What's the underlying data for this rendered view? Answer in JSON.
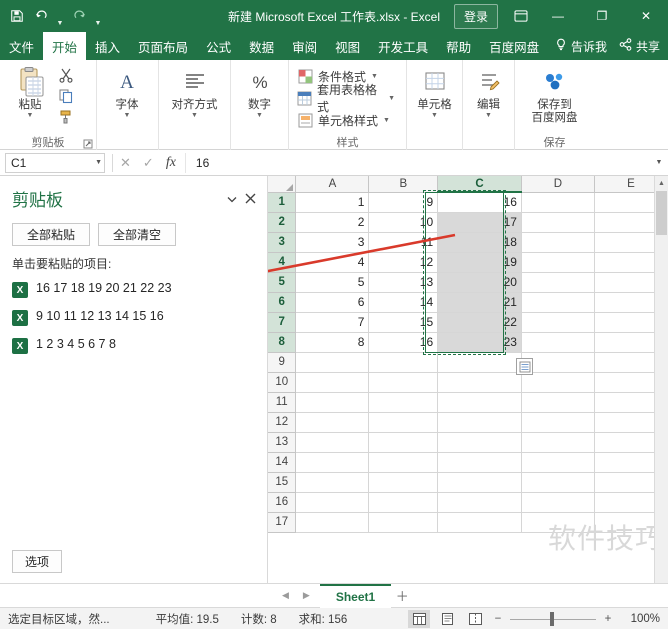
{
  "titlebar": {
    "save_icon": "save-icon",
    "undo_icon": "undo-icon",
    "redo_icon": "redo-icon",
    "customize_icon": "chevron-down-icon",
    "title": "新建 Microsoft Excel 工作表.xlsx  -  Excel",
    "signin_label": "登录",
    "ribbon_display_icon": "ribbon-display-options-icon",
    "minimize_label": "—",
    "restore_label": "❐",
    "close_label": "✕"
  },
  "tabs": [
    {
      "label": "文件",
      "active": false
    },
    {
      "label": "开始",
      "active": true
    },
    {
      "label": "插入",
      "active": false
    },
    {
      "label": "页面布局",
      "active": false
    },
    {
      "label": "公式",
      "active": false
    },
    {
      "label": "数据",
      "active": false
    },
    {
      "label": "审阅",
      "active": false
    },
    {
      "label": "视图",
      "active": false
    },
    {
      "label": "开发工具",
      "active": false
    },
    {
      "label": "帮助",
      "active": false
    },
    {
      "label": "百度网盘",
      "active": false
    }
  ],
  "tabbar_right": {
    "tell_me_icon": "lightbulb-icon",
    "tell_me_label": "告诉我",
    "share_icon": "share-icon",
    "share_label": "共享"
  },
  "ribbon": {
    "groups": [
      {
        "name": "clipboard",
        "label": "剪贴板",
        "paste_label": "粘贴",
        "cut_icon": "scissors-icon",
        "copy_icon": "copy-icon",
        "format_painter_icon": "format-painter-icon",
        "launcher_icon": "dialog-launcher-icon"
      },
      {
        "name": "font",
        "label": "",
        "big_label": "字体",
        "glyph": "A"
      },
      {
        "name": "alignment",
        "label": "",
        "big_label": "对齐方式",
        "glyph": "align-icon"
      },
      {
        "name": "number",
        "label": "",
        "big_label": "数字",
        "glyph": "%"
      },
      {
        "name": "styles",
        "label": "样式",
        "items": [
          {
            "icon": "conditional-format-icon",
            "label": "条件格式"
          },
          {
            "icon": "table-format-icon",
            "label": "套用表格格式"
          },
          {
            "icon": "cell-style-icon",
            "label": "单元格样式"
          }
        ]
      },
      {
        "name": "cells",
        "label": "",
        "big_label": "单元格",
        "glyph": "cells-icon"
      },
      {
        "name": "editing",
        "label": "",
        "big_label": "编辑",
        "glyph": "editing-icon"
      },
      {
        "name": "save-group",
        "label": "保存",
        "big_label": "保存到\n百度网盘",
        "glyph": "baidu-cloud-icon"
      }
    ]
  },
  "formulabar": {
    "namebox_value": "C1",
    "namebox_caret": "chevron-down-icon",
    "cancel_icon": "cancel-icon",
    "confirm_icon": "confirm-icon",
    "fx_label": "fx",
    "formula_value": "16",
    "expand_icon": "chevron-down-icon"
  },
  "clipboard_pane": {
    "title": "剪贴板",
    "menu_icon": "chevron-down-icon",
    "close_icon": "close-icon",
    "paste_all_label": "全部粘贴",
    "clear_all_label": "全部清空",
    "hint": "单击要粘贴的项目:",
    "items": [
      {
        "icon": "excel-item-icon",
        "text": "16 17 18 19 20 21 22 23"
      },
      {
        "icon": "excel-item-icon",
        "text": "9 10 11 12 13 14 15 16"
      },
      {
        "icon": "excel-item-icon",
        "text": "1 2 3 4 5 6 7 8"
      }
    ],
    "options_label": "选项"
  },
  "grid": {
    "columns": [
      "A",
      "B",
      "C",
      "D",
      "E"
    ],
    "selected_column": "C",
    "rows": [
      1,
      2,
      3,
      4,
      5,
      6,
      7,
      8,
      9,
      10,
      11,
      12,
      13,
      14,
      15,
      16,
      17
    ],
    "selected_rows": [
      1,
      2,
      3,
      4,
      5,
      6,
      7,
      8
    ],
    "data": {
      "A": [
        "1",
        "2",
        "3",
        "4",
        "5",
        "6",
        "7",
        "8"
      ],
      "B": [
        "9",
        "10",
        "11",
        "12",
        "13",
        "14",
        "15",
        "16"
      ],
      "C": [
        "16",
        "17",
        "18",
        "19",
        "20",
        "21",
        "22",
        "23"
      ],
      "D": [
        "",
        "",
        "",
        "",
        "",
        "",
        "",
        ""
      ],
      "E": [
        "",
        "",
        "",
        "",
        "",
        "",
        "",
        ""
      ]
    },
    "paste_options_icon": "paste-options-icon",
    "watermark": "软件技巧",
    "scroll_up_icon": "chevron-up-icon",
    "scroll_down_icon": "chevron-down-icon"
  },
  "sheetbar": {
    "nav_first_icon": "chevron-left-icon",
    "nav_last_icon": "chevron-right-icon",
    "sheet_name": "Sheet1",
    "add_sheet_icon": "plus-icon"
  },
  "statusbar": {
    "mode": "选定目标区域，然...",
    "average": "平均值: 19.5",
    "count": "计数: 8",
    "sum": "求和: 156",
    "view_normal_icon": "normal-view-icon",
    "view_layout_icon": "page-layout-view-icon",
    "view_break_icon": "page-break-view-icon",
    "zoom_minus": "−",
    "zoom_plus": "+",
    "zoom_level": "100%"
  },
  "colors": {
    "accent": "#217346",
    "selection_fill": "#d9d9d9",
    "arrow": "#d93a2b"
  }
}
